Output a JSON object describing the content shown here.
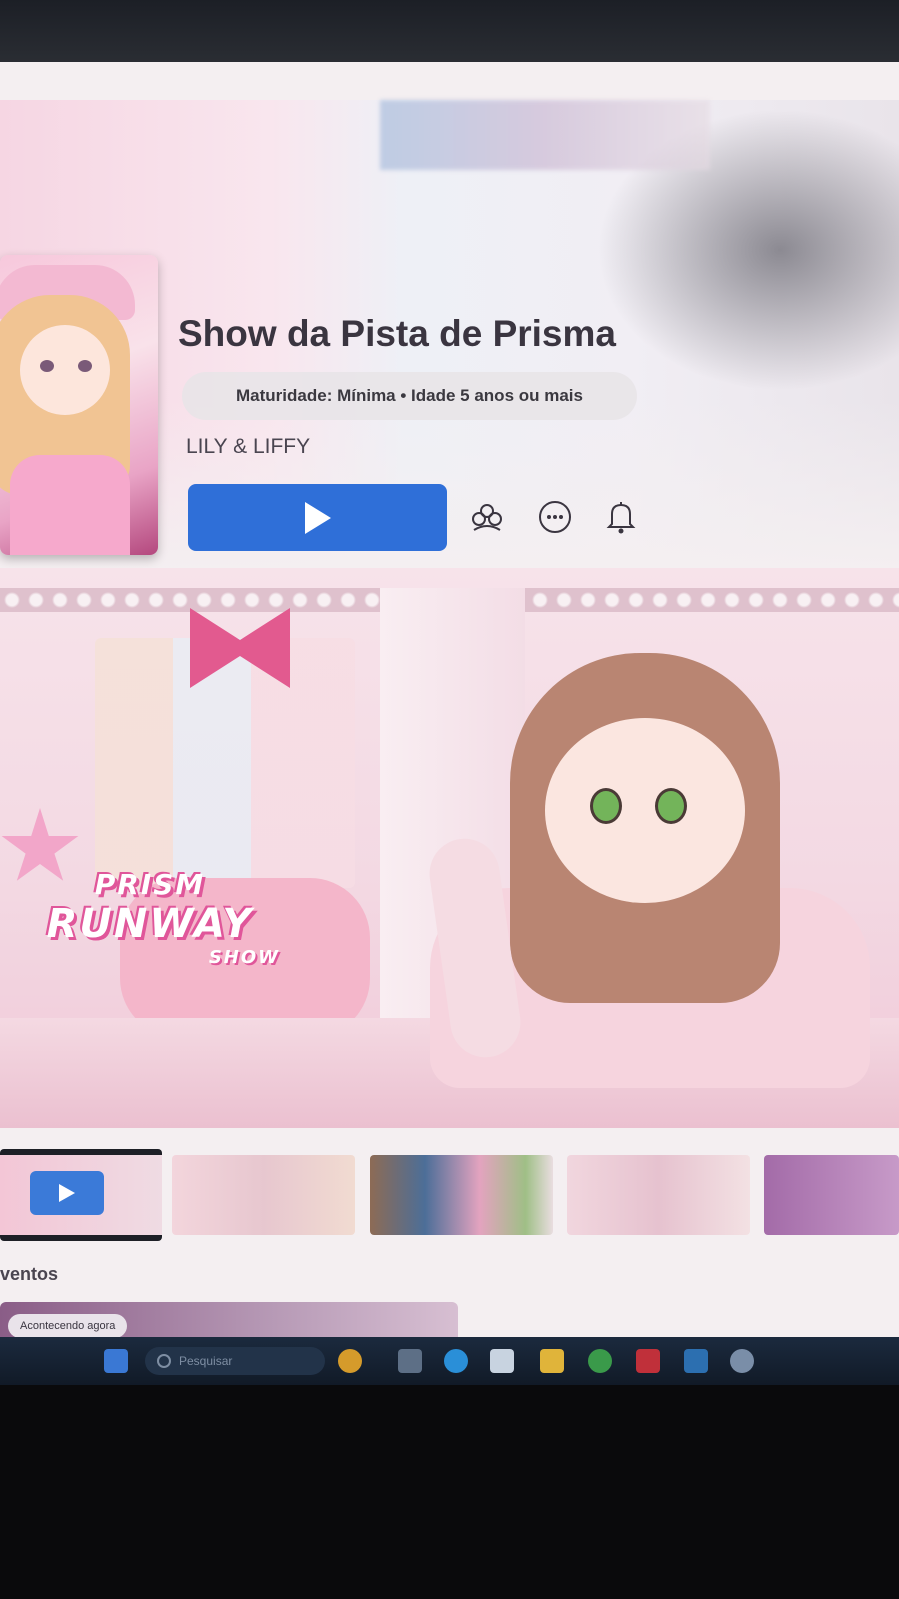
{
  "experience": {
    "title": "Show da Pista de Prisma",
    "maturity": "Maturidade: Mínima • Idade 5 anos ou mais",
    "creator": "LILY & LIFFY"
  },
  "actions": {
    "play": "play-icon",
    "party": "people-icon",
    "more": "more-icon",
    "notify": "bell-icon"
  },
  "artwork": {
    "logo_line1": "PRISM",
    "logo_line2": "RUNWAY",
    "logo_line3": "SHOW"
  },
  "events": {
    "heading": "ventos",
    "badge": "Acontecendo agora"
  },
  "taskbar": {
    "search_placeholder": "Pesquisar"
  },
  "colors": {
    "play_button": "#2f6fd8",
    "accent_pink": "#e0569a"
  }
}
